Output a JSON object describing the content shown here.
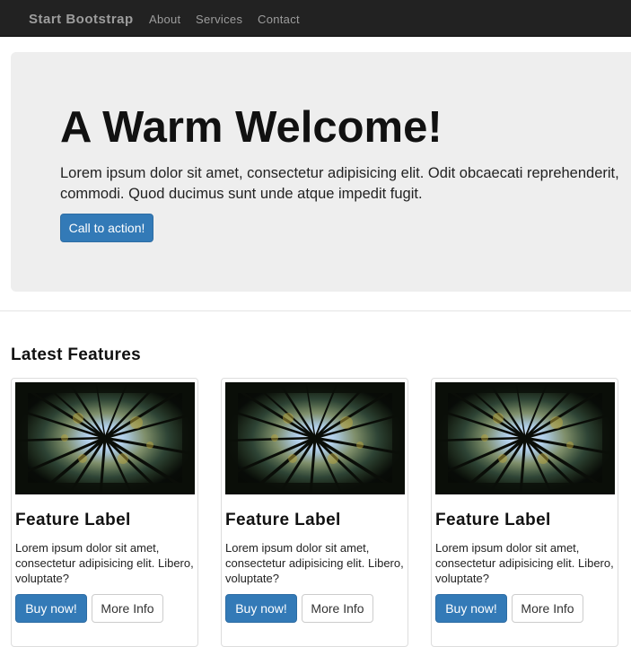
{
  "navbar": {
    "brand": "Start Bootstrap",
    "links": [
      "About",
      "Services",
      "Contact"
    ],
    "background": "#222222",
    "text_color": "#9d9d9d"
  },
  "hero": {
    "title": "A Warm Welcome!",
    "text": "Lorem ipsum dolor sit amet, consectetur adipisicing elit. Odit obcaecati reprehenderit, commodi. Quod ducimus sunt unde atque impedit fugit.",
    "button_label": "Call to action!",
    "background": "#eeeeee"
  },
  "features": {
    "title": "Latest Features",
    "cards": [
      {
        "image_icon": "forest-canopy-image",
        "title": "Feature Label",
        "text": "Lorem ipsum dolor sit amet, consectetur adipisicing elit. Libero, voluptate?",
        "buy_label": "Buy now!",
        "info_label": "More Info"
      },
      {
        "image_icon": "forest-canopy-image",
        "title": "Feature Label",
        "text": "Lorem ipsum dolor sit amet, consectetur adipisicing elit. Libero, voluptate?",
        "buy_label": "Buy now!",
        "info_label": "More Info"
      },
      {
        "image_icon": "forest-canopy-image",
        "title": "Feature Label",
        "text": "Lorem ipsum dolor sit amet, consectetur adipisicing elit. Libero, voluptate?",
        "buy_label": "Buy now!",
        "info_label": "More Info"
      }
    ]
  },
  "colors": {
    "primary": "#337ab7"
  }
}
